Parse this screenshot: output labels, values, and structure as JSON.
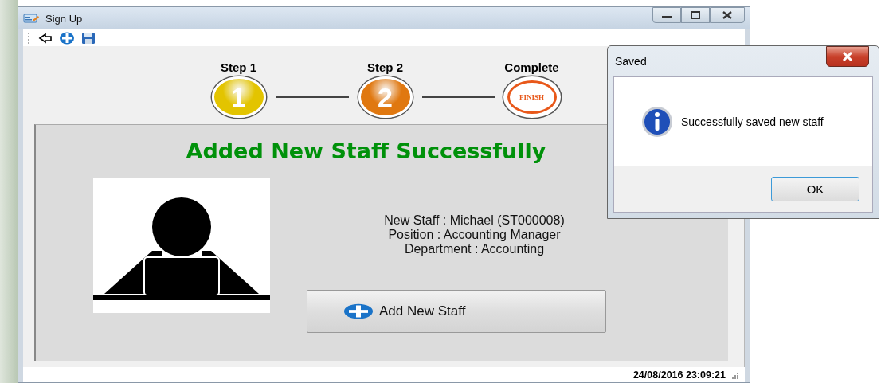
{
  "window": {
    "title": "Sign Up"
  },
  "toolbar": [
    {
      "kind": "back"
    },
    {
      "kind": "add"
    },
    {
      "kind": "save"
    }
  ],
  "steps": [
    {
      "label": "Step 1",
      "badge": "1",
      "kind": "filled",
      "color": "#e3c400"
    },
    {
      "label": "Step 2",
      "badge": "2",
      "kind": "filled",
      "color": "#e07810"
    },
    {
      "label": "Complete",
      "badge": "FINISH",
      "kind": "ring",
      "color": "#e8581a"
    }
  ],
  "panel": {
    "heading": "Added New Staff Successfully",
    "details": [
      "New Staff : Michael (ST000008)",
      "Position : Accounting Manager",
      "Department : Accounting"
    ],
    "button": "Add New Staff"
  },
  "status_bar": {
    "datetime": "24/08/2016 23:09:21"
  },
  "dialog": {
    "title": "Saved",
    "message": "Successfully saved new staff",
    "button": "OK"
  }
}
